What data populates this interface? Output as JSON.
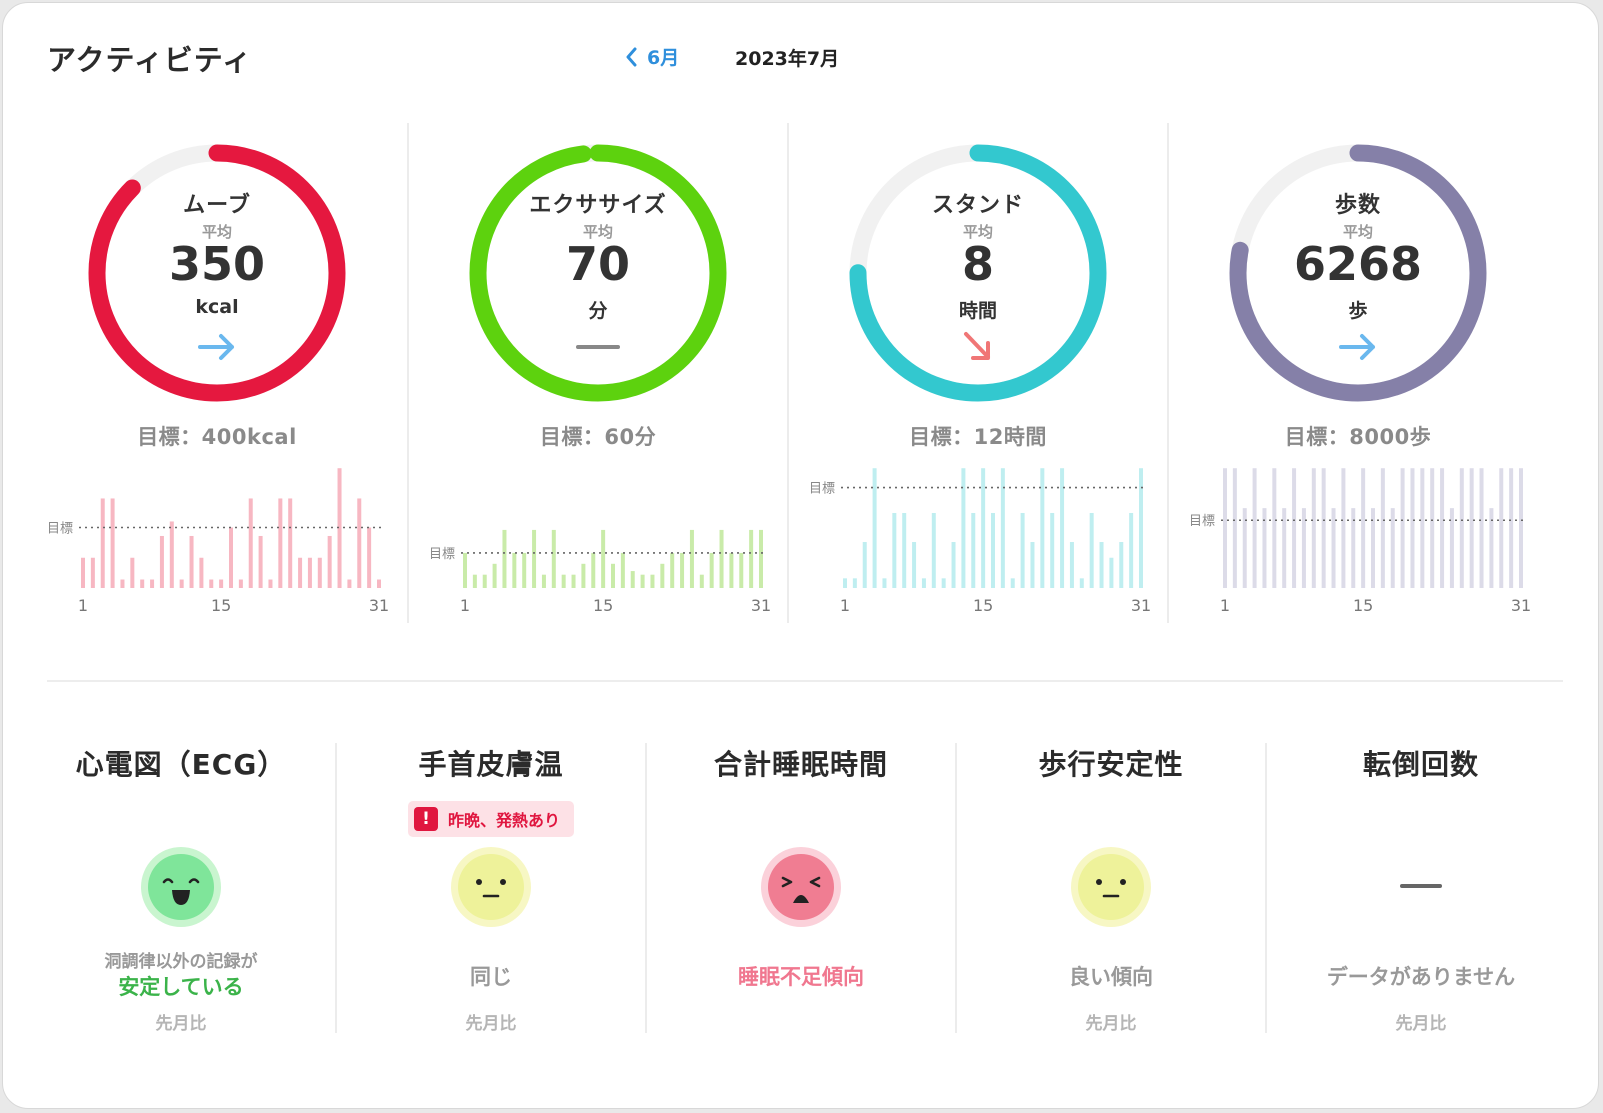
{
  "header": {
    "title": "アクティビティ",
    "prev_month_label": "6月",
    "current_month": "2023年7月"
  },
  "activity": {
    "metrics": [
      {
        "id": "move",
        "label": "ムーブ",
        "avg_label": "平均",
        "value": "350",
        "unit": "kcal",
        "trend": "flat",
        "goal_text": "目標：400kcal",
        "progress": 0.875,
        "color": "#e5183f",
        "bar_color": "#f7b7c2",
        "goal_line_label": "目標",
        "goal_level": 0.5,
        "daily": [
          0.25,
          0.25,
          0.74,
          0.74,
          0.07,
          0.25,
          0.07,
          0.07,
          0.43,
          0.55,
          0.07,
          0.43,
          0.25,
          0.07,
          0.07,
          0.5,
          0.07,
          0.74,
          0.43,
          0.07,
          0.74,
          0.74,
          0.25,
          0.25,
          0.25,
          0.43,
          0.99,
          0.07,
          0.74,
          0.5,
          0.07
        ],
        "x_ticks": [
          "1",
          "15",
          "31"
        ]
      },
      {
        "id": "exercise",
        "label": "エクササイズ",
        "avg_label": "平均",
        "value": "70",
        "unit": "分",
        "trend": "none",
        "goal_text": "目標：60分",
        "progress": 0.98,
        "color": "#5dd20e",
        "bar_color": "#c9eba9",
        "goal_line_label": "目標",
        "goal_level": 0.29,
        "daily": [
          0.29,
          0.11,
          0.11,
          0.2,
          0.48,
          0.29,
          0.29,
          0.48,
          0.11,
          0.48,
          0.11,
          0.11,
          0.2,
          0.29,
          0.48,
          0.2,
          0.29,
          0.14,
          0.11,
          0.11,
          0.2,
          0.29,
          0.29,
          0.48,
          0.11,
          0.29,
          0.48,
          0.29,
          0.29,
          0.48,
          0.48
        ],
        "x_ticks": [
          "1",
          "15",
          "31"
        ]
      },
      {
        "id": "stand",
        "label": "スタンド",
        "avg_label": "平均",
        "value": "8",
        "unit": "時間",
        "trend": "down",
        "goal_text": "目標：12時間",
        "progress": 0.75,
        "color": "#33c8cf",
        "bar_color": "#bfeef0",
        "goal_line_label": "目標",
        "goal_level": 0.83,
        "daily": [
          0.08,
          0.08,
          0.38,
          0.99,
          0.08,
          0.62,
          0.62,
          0.38,
          0.08,
          0.62,
          0.08,
          0.38,
          0.99,
          0.62,
          0.99,
          0.62,
          0.99,
          0.08,
          0.62,
          0.38,
          0.99,
          0.62,
          0.99,
          0.38,
          0.08,
          0.62,
          0.38,
          0.25,
          0.38,
          0.62,
          0.99
        ],
        "x_ticks": [
          "1",
          "15",
          "31"
        ]
      },
      {
        "id": "steps",
        "label": "歩数",
        "avg_label": "平均",
        "value": "6268",
        "unit": "歩",
        "trend": "flat",
        "goal_text": "目標：8000歩",
        "progress": 0.78,
        "color": "#8580a8",
        "bar_color": "#dcdbe8",
        "goal_line_label": "目標",
        "goal_level": 0.56,
        "daily": [
          0.99,
          0.99,
          0.66,
          0.99,
          0.66,
          0.99,
          0.66,
          0.99,
          0.66,
          0.99,
          0.99,
          0.66,
          0.99,
          0.66,
          0.99,
          0.66,
          0.99,
          0.66,
          0.99,
          0.99,
          0.99,
          0.99,
          0.99,
          0.66,
          0.99,
          0.99,
          0.99,
          0.66,
          0.99,
          0.99,
          0.99
        ],
        "x_ticks": [
          "1",
          "15",
          "31"
        ]
      }
    ]
  },
  "health": {
    "items": [
      {
        "id": "ecg",
        "title": "心電図（ECG）",
        "face": "happy",
        "note": "洞調律以外の記録が",
        "status": "安定している",
        "status_color": "#3bb34a",
        "compare": "先月比"
      },
      {
        "id": "wrist-temp",
        "title": "手首皮膚温",
        "face": "neutral",
        "alert": "昨晩、発熱あり",
        "status": "同じ",
        "status_color": "#999999",
        "compare": "先月比"
      },
      {
        "id": "sleep",
        "title": "合計睡眠時間",
        "face": "upset",
        "status": "睡眠不足傾向",
        "status_color": "#f0778f",
        "compare": ""
      },
      {
        "id": "walking-steadiness",
        "title": "歩行安定性",
        "face": "neutral",
        "status": "良い傾向",
        "status_color": "#999999",
        "compare": "先月比"
      },
      {
        "id": "falls",
        "title": "転倒回数",
        "face": "none",
        "status": "データがありません",
        "status_color": "#999999",
        "compare": "先月比"
      }
    ]
  }
}
